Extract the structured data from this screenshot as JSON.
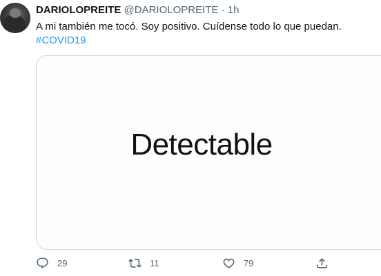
{
  "tweet": {
    "display_name": "DARIOLOPREITE",
    "handle": "@DARIOLOPREITE",
    "separator": "·",
    "time": "1h",
    "text": "A mi también me tocó. Soy positivo. Cuídense todo lo que puedan.",
    "hashtag": "#COVID19",
    "media_text": "Detectable"
  },
  "actions": {
    "reply_icon": "reply-icon",
    "reply_count": "29",
    "retweet_icon": "retweet-icon",
    "retweet_count": "11",
    "like_icon": "heart-icon",
    "like_count": "79",
    "share_icon": "share-icon"
  },
  "colors": {
    "text": "#0f1419",
    "secondary": "#536471",
    "link": "#1d9bf0",
    "border": "#cfd9de"
  }
}
